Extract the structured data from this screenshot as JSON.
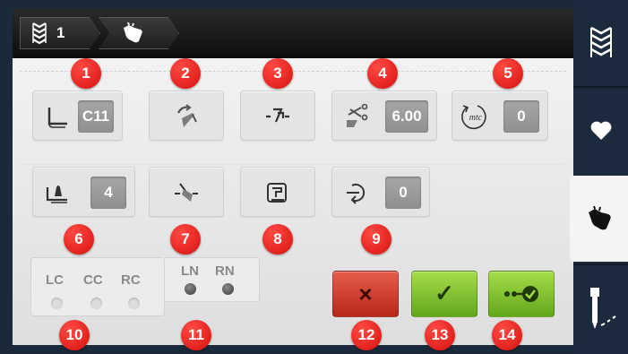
{
  "breadcrumb": {
    "stitch_number": "1"
  },
  "tiles": {
    "presser_foot": {
      "value": "C11"
    },
    "stitch_length": {
      "value": "6.00"
    },
    "mtc": {
      "icon_text": "mtc",
      "value": "0"
    },
    "foot_pressure": {
      "value": "4"
    },
    "thread_tension": {
      "value": "0"
    }
  },
  "footer": {
    "lc": "LC",
    "cc": "CC",
    "rc": "RC",
    "ln": "LN",
    "rn": "RN"
  },
  "buttons": {
    "cancel_glyph": "×",
    "confirm_glyph": "✓"
  },
  "callouts": [
    "1",
    "2",
    "3",
    "4",
    "5",
    "6",
    "7",
    "8",
    "9",
    "10",
    "11",
    "12",
    "13",
    "14"
  ],
  "colors": {
    "accent_red": "#e3201b",
    "confirm_green": "#7dc12f",
    "cancel_red": "#c93526",
    "rail": "#1b2b3d"
  }
}
